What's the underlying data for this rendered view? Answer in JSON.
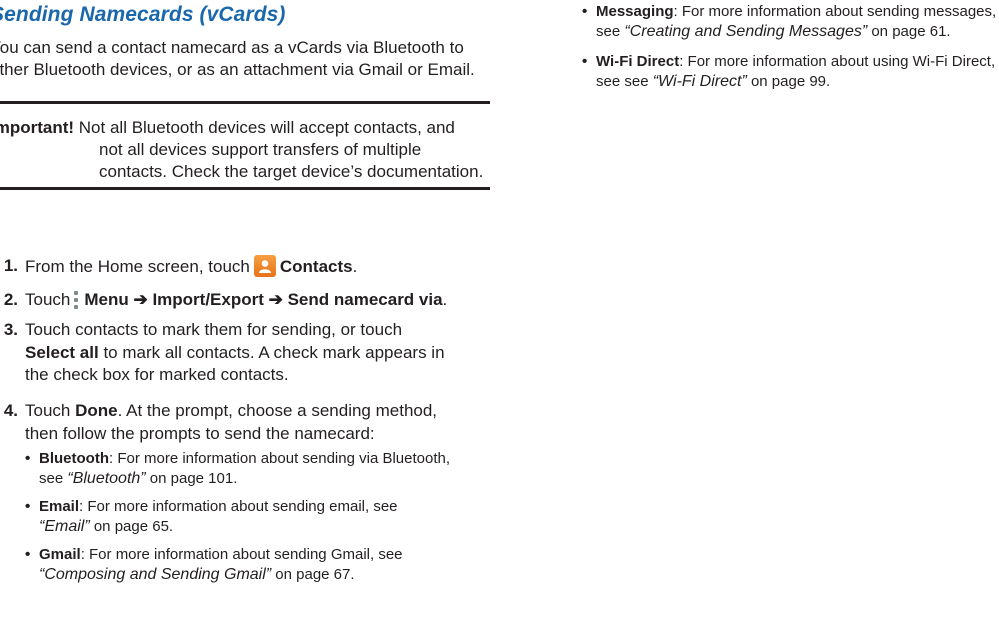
{
  "heading": "Sending Namecards (vCards)",
  "intro": "You can send a contact namecard as a vCards via Bluetooth to other Bluetooth devices, or as an attachment via Gmail or Email.",
  "important": {
    "label": "Important!",
    "line1": "Not all Bluetooth devices will accept contacts, and",
    "line2": "not all devices support transfers of multiple",
    "line3": "contacts. Check the target device’s documentation."
  },
  "steps": [
    {
      "num": "1.",
      "pre": "From the Home screen, touch",
      "icon": "contacts-app-icon",
      "bold": "Contacts",
      "post": "."
    },
    {
      "num": "2.",
      "pre": "Touch",
      "icon": "menu-dots-icon",
      "bold": "Menu ➔ Import/Export ➔ Send namecard via",
      "post": "."
    },
    {
      "num": "3.",
      "pre": "Touch contacts to mark them for sending, or touch",
      "bold": "Select all",
      "post": " to mark all contacts. A check mark appears in",
      "line3": "the check box for marked contacts."
    },
    {
      "num": "4.",
      "pre": "Touch",
      "bold": "Done",
      "post": ". At the prompt, choose a sending method,",
      "line2": "then follow the prompts to send the namecard:"
    }
  ],
  "sub_bullets": [
    {
      "bold": "Bluetooth",
      "text": ": For more information about sending via Bluetooth,",
      "see": "see",
      "ref": "“Bluetooth”",
      "page": " on page 101."
    },
    {
      "bold": "Email",
      "text": ": For more information about sending email, see",
      "ref": "“Email”",
      "page": " on page 65."
    },
    {
      "bold": "Gmail",
      "text": ": For more information about sending Gmail, see",
      "ref": "“Composing and Sending Gmail”",
      "page": " on page 67."
    }
  ],
  "right_bullets": [
    {
      "bold": "Messaging",
      "text": ": For more information about sending messages,",
      "see": "see",
      "ref": "“Creating and Sending Messages”",
      "page": " on page 61."
    },
    {
      "bold": "Wi-Fi Direct",
      "text": ": For more information about using Wi-Fi Direct,",
      "see": "see see",
      "ref": "“Wi-Fi Direct”",
      "page": " on page 99."
    }
  ],
  "bullet_char": "•",
  "colors": {
    "heading": "#1a67ac",
    "text": "#231f20",
    "contacts_icon": "#f0892e"
  }
}
